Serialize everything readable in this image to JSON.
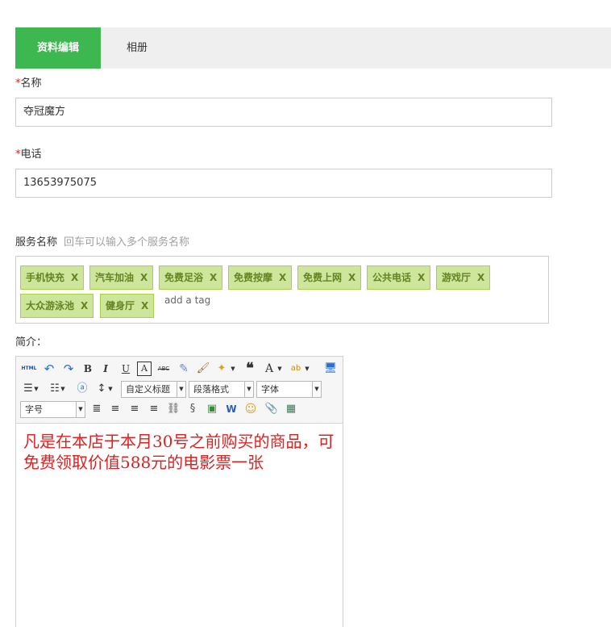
{
  "tabs": [
    {
      "label": "资料编辑"
    },
    {
      "label": "相册"
    }
  ],
  "form": {
    "name": {
      "required_mark": "*",
      "label": "名称",
      "value": "夺冠魔方"
    },
    "phone": {
      "required_mark": "*",
      "label": "电话",
      "value": "13653975075"
    },
    "services": {
      "label": "服务名称",
      "hint": "回车可以输入多个服务名称",
      "tags": [
        "手机快充",
        "汽车加油",
        "免费足浴",
        "免费按摩",
        "免费上网",
        "公共电话",
        "游戏厅",
        "大众游泳池",
        "健身厅"
      ],
      "remove_label": "X",
      "add_placeholder": "add a tag"
    },
    "intro": {
      "label": "简介："
    }
  },
  "editor": {
    "html_label": "HTML",
    "dropdowns": {
      "heading": "自定义标题",
      "paragraph": "段落格式",
      "font_family": "字体",
      "font_size": "字号"
    },
    "content": "凡是在本店于本月30号之前购买的商品，可免费领取价值588元的电影票一张",
    "content_color": "#e02020"
  },
  "colors": {
    "accent": "#3db850",
    "tag_bg": "#cde69c",
    "tag_border": "#a5d24a",
    "tag_text": "#638421",
    "required": "#e02020"
  }
}
